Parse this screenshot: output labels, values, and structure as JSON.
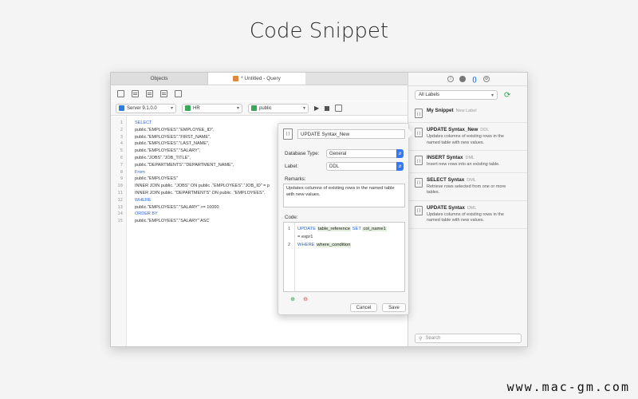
{
  "page": {
    "title": "Code Snippet"
  },
  "tabs": {
    "objects": "Objects",
    "query": "* Untitled - Query"
  },
  "toolbar": {
    "server": "Server 9.1.0.0",
    "database": "HR",
    "schema": "public"
  },
  "editor": {
    "lines": [
      "SELECT",
      "public.\"EMPLOYEES\".\"EMPLOYEE_ID\",",
      "public.\"EMPLOYEES\".\"FIRST_NAME\",",
      "public.\"EMPLOYEES\".\"LAST_NAME\",",
      "public.\"EMPLOYEES\".\"SALARY\",",
      "public.\"JOBS\".\"JOB_TITLE\",",
      "public.\"DEPARTMENTS\".\"DEPARTMENT_NAME\",",
      "From",
      "public.\"EMPLOYEES\"",
      "INNER JOIN public. \"JOBS\" ON public .\"EMPLOYEES\".\"JOB_ID\" = p",
      "INNER JOIN public. \"DEPARTMENTS\" ON public .\"EMPLOYEES\".",
      "WHERE",
      "public.\"EMPLOYEES\".\"SALARY\" >= 10000",
      "ORDER BY",
      "public.\"EMPLOYEES\".\"SALARY\" ASC"
    ],
    "line_numbers": [
      "1",
      "2",
      "3",
      "4",
      "5",
      "6",
      "7",
      "8",
      "9",
      "10",
      "11",
      "12",
      "13",
      "14",
      "15"
    ]
  },
  "popover": {
    "name": "UPDATE Syntax_New",
    "db_type_label": "Database Type:",
    "db_type_value": "General",
    "label_label": "Label:",
    "label_value": "DDL",
    "remarks_label": "Remarks:",
    "remarks_value": "Updates columns of existing rows in the named table with new values.",
    "code_label": "Code:",
    "code": {
      "l1_kw1": "UPDATE",
      "l1_ph1": "table_reference",
      "l1_kw2": "SET",
      "l1_ph2": "col_name1",
      "l1b": "= expr1",
      "l2_kw": "WHERE",
      "l2_ph": "where_condition"
    },
    "cancel": "Cancel",
    "save": "Save"
  },
  "sidebar": {
    "filter": "All Labels",
    "search_placeholder": "Search",
    "snippets": [
      {
        "title": "My Snippet",
        "tag": "New Label",
        "desc": ""
      },
      {
        "title": "UPDATE Syntax_New",
        "tag": "DDL",
        "desc": "Updates columns of existing rows in the named table with new values."
      },
      {
        "title": "INSERT Syntax",
        "tag": "DML",
        "desc": "Insert new rows into an existing table."
      },
      {
        "title": "SELECT Syntax",
        "tag": "DML",
        "desc": "Retrieve rows selected from one or more tables."
      },
      {
        "title": "UPDATE Syntax",
        "tag": "DML",
        "desc": "Updates columns of existing rows in the named table with new values."
      }
    ]
  },
  "watermark": "www.mac-gm.com",
  "colors": {
    "keyword": "#2a66d9",
    "number": "#1f9d3a",
    "accent": "#3478f6"
  }
}
